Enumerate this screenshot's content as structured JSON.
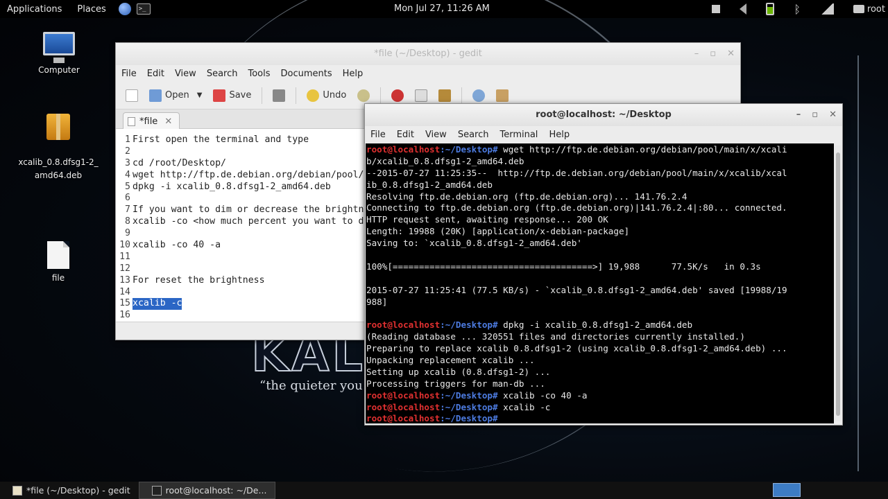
{
  "top_panel": {
    "applications": "Applications",
    "places": "Places",
    "clock": "Mon Jul 27, 11:26 AM",
    "user": "root"
  },
  "desktop": {
    "icons": [
      {
        "label": "Computer"
      },
      {
        "label": "xcalib_0.8.dfsg1-2_\namd64.deb"
      },
      {
        "label": "file"
      }
    ],
    "brand": "KALI LINUX",
    "tagline": "“the quieter you become, the more you are able to hear”"
  },
  "gedit": {
    "title": "*file (~/Desktop) - gedit",
    "menu": [
      "File",
      "Edit",
      "View",
      "Search",
      "Tools",
      "Documents",
      "Help"
    ],
    "toolbar": {
      "open": "Open",
      "save": "Save",
      "undo": "Undo"
    },
    "tab_label": "*file",
    "lines": [
      {
        "n": "1",
        "text": "First open the terminal and type"
      },
      {
        "n": "2",
        "text": ""
      },
      {
        "n": "3",
        "text": "cd /root/Desktop/"
      },
      {
        "n": "4",
        "text": "wget http://ftp.de.debian.org/debian/pool/main/x/xcalib/xcalib_0.8.dfsg1-2_amd64.deb"
      },
      {
        "n": "5",
        "text": "dpkg -i xcalib_0.8.dfsg1-2_amd64.deb"
      },
      {
        "n": "6",
        "text": ""
      },
      {
        "n": "7",
        "text": "If you want to dim or decrease the brightness"
      },
      {
        "n": "8",
        "text": "xcalib -co <how much percent you want to dim> -a"
      },
      {
        "n": "9",
        "text": ""
      },
      {
        "n": "10",
        "text": "xcalib -co 40 -a"
      },
      {
        "n": "11",
        "text": ""
      },
      {
        "n": "12",
        "text": ""
      },
      {
        "n": "13",
        "text": "For reset the brightness"
      },
      {
        "n": "14",
        "text": ""
      },
      {
        "n": "15",
        "text": "xcalib -c"
      },
      {
        "n": "16",
        "text": ""
      }
    ]
  },
  "terminal": {
    "title": "root@localhost: ~/Desktop",
    "menu": [
      "File",
      "Edit",
      "View",
      "Search",
      "Terminal",
      "Help"
    ],
    "prompt_user": "root@localhost",
    "prompt_path": ":~/Desktop#",
    "lines": [
      {
        "prompt": true,
        "text": " wget http://ftp.de.debian.org/debian/pool/main/x/xcali"
      },
      {
        "prompt": false,
        "text": "b/xcalib_0.8.dfsg1-2_amd64.deb"
      },
      {
        "prompt": false,
        "text": "--2015-07-27 11:25:35--  http://ftp.de.debian.org/debian/pool/main/x/xcalib/xcal"
      },
      {
        "prompt": false,
        "text": "ib_0.8.dfsg1-2_amd64.deb"
      },
      {
        "prompt": false,
        "text": "Resolving ftp.de.debian.org (ftp.de.debian.org)... 141.76.2.4"
      },
      {
        "prompt": false,
        "text": "Connecting to ftp.de.debian.org (ftp.de.debian.org)|141.76.2.4|:80... connected."
      },
      {
        "prompt": false,
        "text": "HTTP request sent, awaiting response... 200 OK"
      },
      {
        "prompt": false,
        "text": "Length: 19988 (20K) [application/x-debian-package]"
      },
      {
        "prompt": false,
        "text": "Saving to: `xcalib_0.8.dfsg1-2_amd64.deb'"
      },
      {
        "prompt": false,
        "text": ""
      },
      {
        "prompt": false,
        "text": "100%[======================================>] 19,988      77.5K/s   in 0.3s"
      },
      {
        "prompt": false,
        "text": ""
      },
      {
        "prompt": false,
        "text": "2015-07-27 11:25:41 (77.5 KB/s) - `xcalib_0.8.dfsg1-2_amd64.deb' saved [19988/19"
      },
      {
        "prompt": false,
        "text": "988]"
      },
      {
        "prompt": false,
        "text": ""
      },
      {
        "prompt": true,
        "text": " dpkg -i xcalib_0.8.dfsg1-2_amd64.deb"
      },
      {
        "prompt": false,
        "text": "(Reading database ... 320551 files and directories currently installed.)"
      },
      {
        "prompt": false,
        "text": "Preparing to replace xcalib 0.8.dfsg1-2 (using xcalib_0.8.dfsg1-2_amd64.deb) ..."
      },
      {
        "prompt": false,
        "text": "Unpacking replacement xcalib ..."
      },
      {
        "prompt": false,
        "text": "Setting up xcalib (0.8.dfsg1-2) ..."
      },
      {
        "prompt": false,
        "text": "Processing triggers for man-db ..."
      },
      {
        "prompt": true,
        "text": " xcalib -co 40 -a"
      },
      {
        "prompt": true,
        "text": " xcalib -c"
      },
      {
        "prompt": true,
        "text": ""
      }
    ]
  },
  "taskbar": {
    "items": [
      {
        "label": "*file (~/Desktop) - gedit"
      },
      {
        "label": "root@localhost: ~/De..."
      }
    ]
  }
}
